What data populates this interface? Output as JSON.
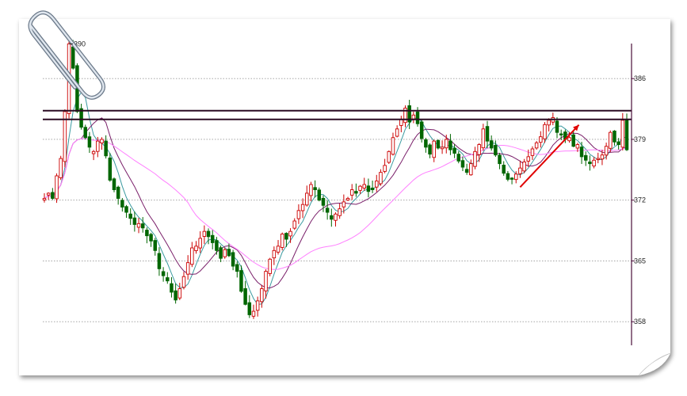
{
  "chart_data": {
    "type": "candlestick",
    "title": "",
    "xlabel": "",
    "ylabel": "",
    "ylim": [
      3551,
      3914
    ],
    "y_ticks": [
      {
        "value": 3860,
        "label": "386"
      },
      {
        "value": 3790,
        "label": "379"
      },
      {
        "value": 3720,
        "label": "372"
      },
      {
        "value": 3650,
        "label": "365"
      },
      {
        "value": 3580,
        "label": "358"
      }
    ],
    "gridlines": "dotted horizontal",
    "peak_label": {
      "value": 3900,
      "text": "390"
    },
    "horizontal_lines": [
      3823,
      3813
    ],
    "trendline": {
      "from_bar": 116,
      "from_value": 3735,
      "to_bar": 128,
      "to_value": 3803
    },
    "colors": {
      "up": "#cc0000",
      "down": "#006600",
      "ma_fast": "#3a9aa0",
      "ma_mid": "#7a1f6a",
      "ma_slow": "#ff80ff",
      "resistance": "#2a0a22",
      "trendline": "#e00000",
      "grid": "#999999",
      "axis": "#4a0f3a"
    },
    "ma_periods": [
      5,
      10,
      30
    ],
    "bars_close": [
      3722,
      3728,
      3722,
      3748,
      3768,
      3822,
      3900,
      3872,
      3822,
      3804,
      3792,
      3781,
      3776,
      3788,
      3790,
      3771,
      3743,
      3732,
      3722,
      3712,
      3706,
      3699,
      3692,
      3693,
      3688,
      3679,
      3673,
      3662,
      3641,
      3633,
      3627,
      3614,
      3605,
      3618,
      3632,
      3648,
      3665,
      3667,
      3676,
      3684,
      3678,
      3671,
      3662,
      3653,
      3663,
      3656,
      3644,
      3638,
      3615,
      3600,
      3588,
      3592,
      3604,
      3618,
      3638,
      3652,
      3662,
      3667,
      3681,
      3675,
      3684,
      3696,
      3708,
      3715,
      3728,
      3738,
      3732,
      3720,
      3714,
      3706,
      3698,
      3704,
      3710,
      3718,
      3722,
      3732,
      3728,
      3736,
      3738,
      3730,
      3732,
      3742,
      3752,
      3760,
      3776,
      3792,
      3802,
      3813,
      3826,
      3810,
      3818,
      3808,
      3791,
      3781,
      3773,
      3788,
      3780,
      3781,
      3790,
      3778,
      3774,
      3765,
      3758,
      3752,
      3762,
      3776,
      3784,
      3802,
      3788,
      3780,
      3772,
      3762,
      3751,
      3744,
      3744,
      3750,
      3757,
      3764,
      3770,
      3779,
      3786,
      3793,
      3807,
      3812,
      3815,
      3798,
      3795,
      3790,
      3792,
      3782,
      3784,
      3770,
      3766,
      3762,
      3766,
      3768,
      3772,
      3782,
      3798,
      3787,
      3784,
      3812,
      3778
    ],
    "series": [
      {
        "name": "",
        "values": []
      }
    ]
  }
}
